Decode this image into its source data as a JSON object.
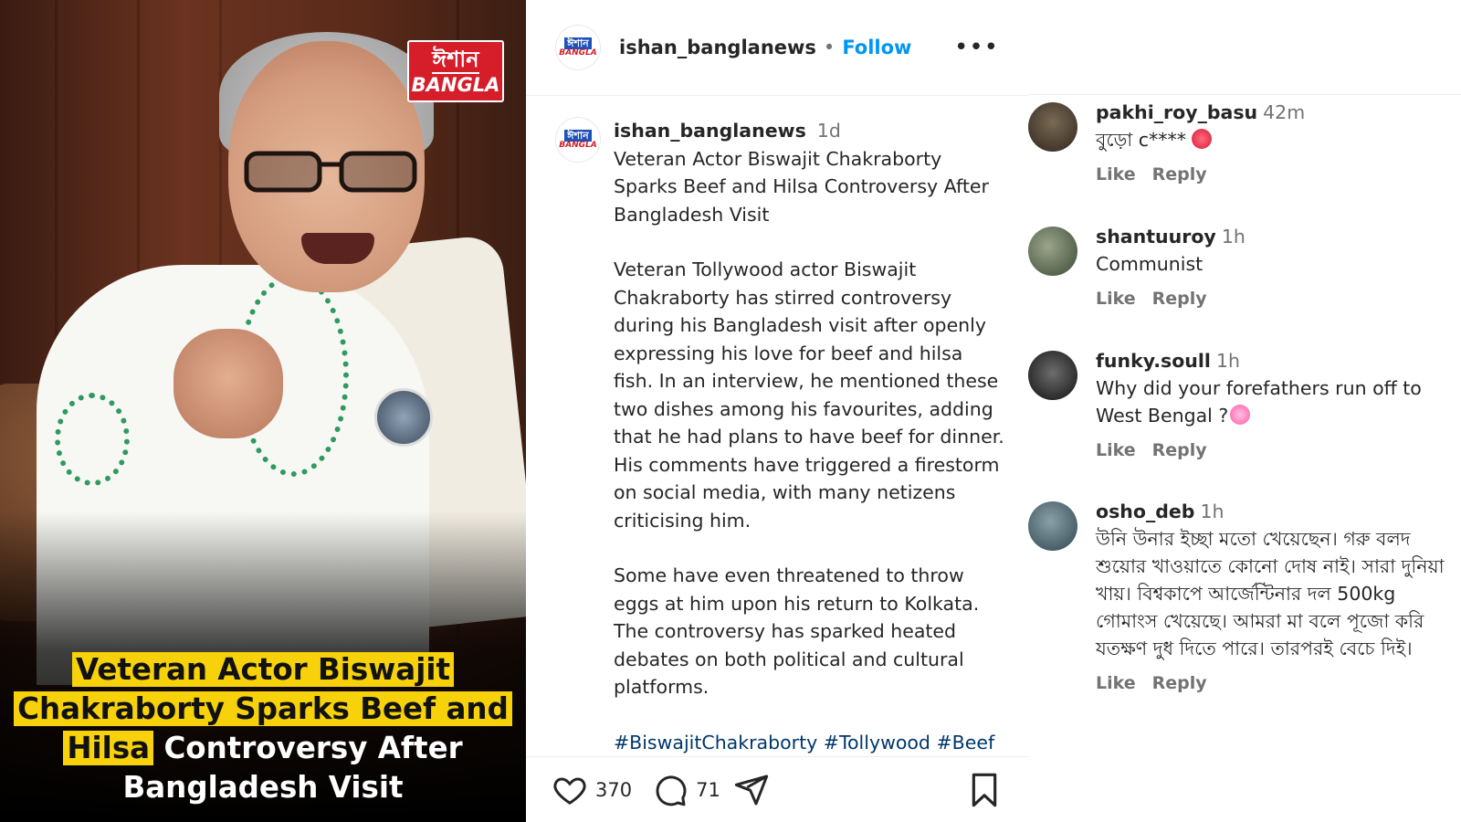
{
  "media": {
    "brand_logo": {
      "line1": "ঈশান",
      "line2": "BANGLA"
    },
    "headline": {
      "line1_highlight": "Veteran Actor Biswajit",
      "line2_highlight": "Chakraborty Sparks Beef and",
      "line3_highlight": "Hilsa",
      "line3_rest": "Controversy After",
      "line4": "Bangladesh Visit"
    }
  },
  "post_header": {
    "username": "ishan_banglanews",
    "separator": "•",
    "follow_label": "Follow",
    "more_label": "•••",
    "avatar_text": {
      "line1": "ঈশান",
      "line2": "BANGLA"
    }
  },
  "caption": {
    "username": "ishan_banglanews",
    "time": "1d",
    "title": "Veteran Actor Biswajit Chakraborty Sparks Beef and Hilsa Controversy After Bangladesh Visit",
    "paragraph1": "Veteran Tollywood actor Biswajit Chakraborty has stirred controversy during his Bangladesh visit after openly expressing his love for beef and hilsa fish. In an interview, he mentioned these two dishes among his favourites, adding that he had plans to have beef for dinner. His comments have triggered a firestorm on social media, with many netizens criticising him.",
    "paragraph2": "Some have even threatened to throw eggs at him upon his return to Kolkata. The controversy has sparked heated debates on both political and cultural platforms.",
    "hashtags": [
      "#BiswajitChakraborty",
      "#Tollywood",
      "#Beef"
    ]
  },
  "actions": {
    "like_count": "370",
    "comment_count": "71",
    "icons": [
      "heart-icon",
      "comment-icon",
      "share-icon",
      "bookmark-icon"
    ]
  },
  "comments": [
    {
      "username": "pakhi_roy_basu",
      "time": "42m",
      "text": "বুড়ো c****",
      "emoji": "angry-face",
      "like_label": "Like",
      "reply_label": "Reply"
    },
    {
      "username": "shantuuroy",
      "time": "1h",
      "text": "Communist",
      "like_label": "Like",
      "reply_label": "Reply"
    },
    {
      "username": "funky.soull",
      "time": "1h",
      "text": "Why did your forefathers run off to West Bengal ?",
      "emoji": "shocked-face",
      "like_label": "Like",
      "reply_label": "Reply"
    },
    {
      "username": "osho_deb",
      "time": "1h",
      "text": "উনি উনার ইচ্ছা মতো খেয়েছেন। গরু বলদ শুয়োর খাওয়াতে কোনো দোষ নাই। সারা দুনিয়া খায়। বিশ্বকাপে আর্জেন্টিনার দল 500kg গোমাংস খেয়েছে। আমরা মা বলে পূজো করি যতক্ষণ দুধ দিতে পারে। তারপরই বেচে দিই।",
      "like_label": "Like",
      "reply_label": "Reply"
    }
  ],
  "colors": {
    "follow_blue": "#0095f6",
    "hashtag_blue": "#00376b",
    "headline_highlight": "#f7d20a",
    "brand_red": "#d51e2a",
    "muted_text": "#737373"
  }
}
